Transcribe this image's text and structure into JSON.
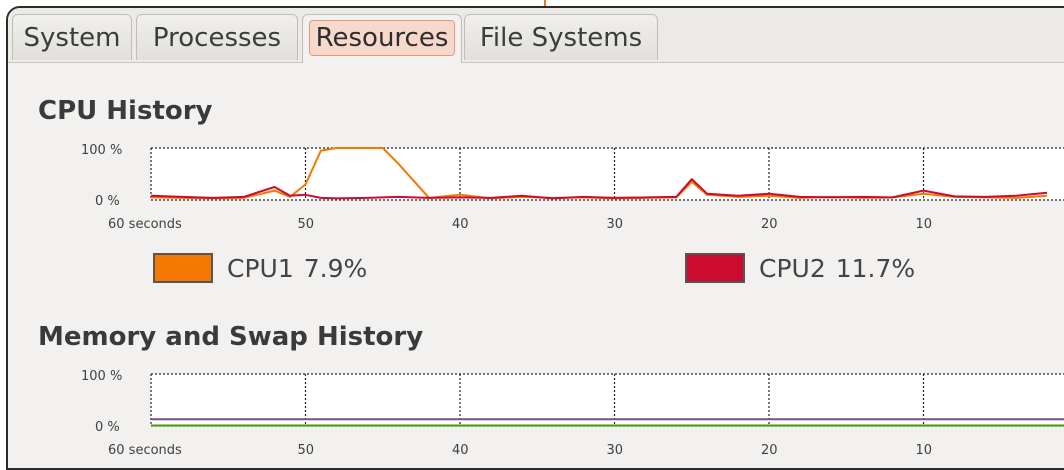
{
  "tabs": [
    {
      "label": "System",
      "active": false
    },
    {
      "label": "Processes",
      "active": false
    },
    {
      "label": "Resources",
      "active": true
    },
    {
      "label": "File Systems",
      "active": false
    }
  ],
  "cpu": {
    "title": "CPU History",
    "y_top": "100 %",
    "y_bottom": "0 %",
    "x_labels": [
      "60 seconds",
      "50",
      "40",
      "30",
      "20",
      "10"
    ],
    "legend": [
      {
        "label": "CPU1",
        "value": "7.9%",
        "color": "#f57900"
      },
      {
        "label": "CPU2",
        "value": "11.7%",
        "color": "#cc0c2f"
      }
    ]
  },
  "memory": {
    "title": "Memory and Swap History",
    "y_top": "100 %",
    "y_bottom": "0 %",
    "x_labels": [
      "60 seconds",
      "50",
      "40",
      "30",
      "20",
      "10"
    ]
  },
  "chart_data": [
    {
      "type": "line",
      "title": "CPU History",
      "xlabel": "",
      "ylabel": "",
      "ylim": [
        0,
        100
      ],
      "x": [
        60,
        58,
        56,
        54,
        52,
        51,
        50,
        49,
        48,
        46,
        45,
        44,
        42,
        40,
        38,
        36,
        34,
        32,
        30,
        28,
        26,
        25,
        24,
        22,
        20,
        18,
        16,
        14,
        12,
        10,
        8,
        6,
        4,
        2
      ],
      "series": [
        {
          "name": "CPU1",
          "color": "#f57900",
          "values": [
            5,
            4,
            3,
            4,
            18,
            6,
            30,
            95,
            100,
            100,
            100,
            70,
            4,
            10,
            3,
            6,
            4,
            5,
            3,
            4,
            5,
            35,
            10,
            6,
            8,
            4,
            6,
            4,
            5,
            12,
            6,
            5,
            4,
            8
          ]
        },
        {
          "name": "CPU2",
          "color": "#cc0c2f",
          "values": [
            8,
            6,
            4,
            6,
            25,
            8,
            10,
            4,
            3,
            4,
            5,
            6,
            4,
            5,
            4,
            8,
            3,
            6,
            4,
            5,
            6,
            40,
            12,
            8,
            12,
            6,
            5,
            6,
            5,
            18,
            7,
            6,
            8,
            14
          ]
        }
      ]
    },
    {
      "type": "line",
      "title": "Memory and Swap History",
      "xlabel": "",
      "ylabel": "",
      "ylim": [
        0,
        100
      ],
      "x": [
        60,
        0
      ],
      "series": [
        {
          "color": "#75507b",
          "values": [
            13,
            13
          ]
        },
        {
          "color": "#4e9a06",
          "values": [
            1,
            1
          ]
        }
      ]
    }
  ]
}
